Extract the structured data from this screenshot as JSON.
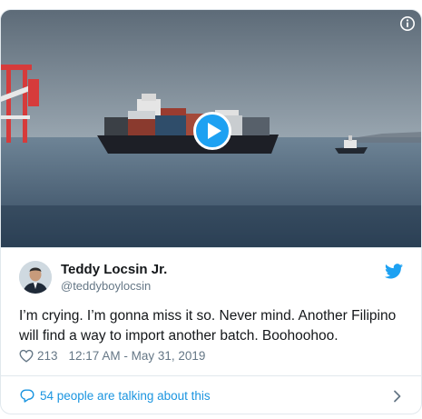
{
  "tweet": {
    "author_name": "Teddy Locsin Jr.",
    "author_handle": "@teddyboylocsin",
    "text": "I’m crying. I’m gonna miss it so. Never mind. Another Filipino will find a way to import another batch. Boohoohoo.",
    "likes": "213",
    "timestamp": "12:17 AM - May 31, 2019",
    "conversation_link": "54 people are talking about this"
  },
  "icons": {
    "info": "info-icon",
    "play": "play-icon",
    "brand": "twitter-bird-icon",
    "like": "heart-icon",
    "reply": "speech-bubble-icon",
    "more": "chevron-right-icon"
  },
  "colors": {
    "brand_blue": "#1da1f2",
    "link_blue": "#1b95e0",
    "muted": "#657786",
    "border": "#e1e8ed"
  }
}
